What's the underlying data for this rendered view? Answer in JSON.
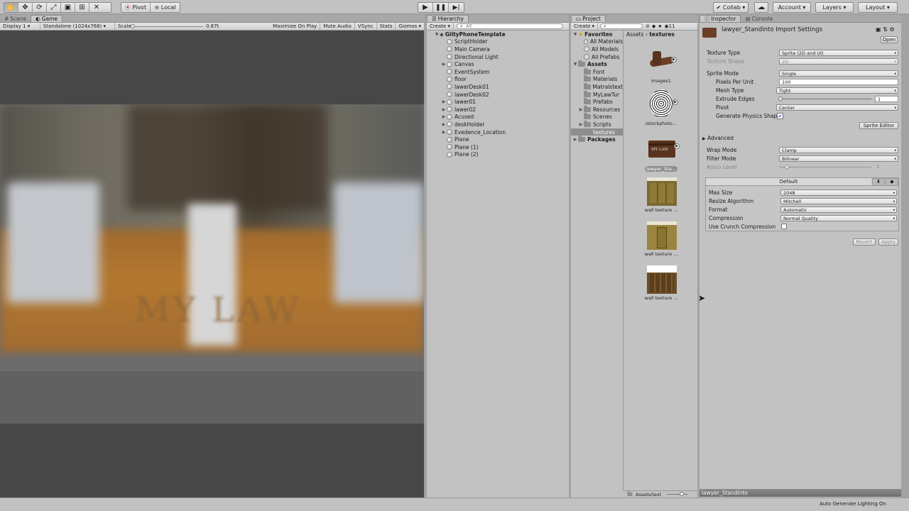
{
  "toolbar": {
    "pivot": "Pivot",
    "local": "Local",
    "collab": "Collab",
    "account": "Account",
    "layers": "Layers",
    "layout": "Layout"
  },
  "scene_tabs": {
    "scene": "Scene",
    "game": "Game"
  },
  "game_bar": {
    "display": "Display 1",
    "resolution": "Standalone (1024x768)",
    "scale_label": "Scale",
    "scale_value": "0.87t",
    "maximize": "Maximize On Play",
    "mute": "Mute Audio",
    "vsync": "VSync",
    "stats": "Stats",
    "gizmos": "Gizmos"
  },
  "game_view": {
    "wall_text": "MY LAW"
  },
  "hierarchy": {
    "tab": "Hierarchy",
    "create": "Create",
    "search_placeholder": "All",
    "scene": "GiltyPhoneTemplate",
    "items": [
      {
        "label": "ScriptHolder",
        "expandable": false
      },
      {
        "label": "Main Camera",
        "expandable": false
      },
      {
        "label": "Directional Light",
        "expandable": false
      },
      {
        "label": "Canvas",
        "expandable": true
      },
      {
        "label": "EventSystem",
        "expandable": false
      },
      {
        "label": "floor",
        "expandable": false
      },
      {
        "label": "lawerDesk01",
        "expandable": false
      },
      {
        "label": "lawerDesk02",
        "expandable": false
      },
      {
        "label": "lawer01",
        "expandable": true
      },
      {
        "label": "lawer02",
        "expandable": true
      },
      {
        "label": "Acused",
        "expandable": true
      },
      {
        "label": "deskHolder",
        "expandable": true
      },
      {
        "label": "Evedence_Location",
        "expandable": true
      },
      {
        "label": "Plane",
        "expandable": false
      },
      {
        "label": "Plane (1)",
        "expandable": false
      },
      {
        "label": "Plane (2)",
        "expandable": false
      }
    ]
  },
  "project": {
    "tab": "Project",
    "create": "Create",
    "count": "11",
    "favorites": "Favorites",
    "fav_items": [
      "All Materials",
      "All Models",
      "All Prefabs"
    ],
    "assets": "Assets",
    "folders": [
      "Font",
      "Materials",
      "Matralstext",
      "MyLawTur",
      "Prefabs",
      "Resources",
      "Scenes",
      "Scripts",
      "textures"
    ],
    "packages": "Packages",
    "breadcrumb_root": "Assets",
    "breadcrumb_sep": "›",
    "breadcrumb_current": "textures",
    "assets_list": [
      {
        "label": "images1"
      },
      {
        "label": "istockphoto..."
      },
      {
        "label": "lawyer_Sta...",
        "thumb_text": "MY LAW"
      },
      {
        "label": "wall texture ..."
      },
      {
        "label": "wall texture ..."
      },
      {
        "label": "wall texture ..."
      }
    ],
    "footer_path": "Assets/text"
  },
  "inspector": {
    "tab": "Inspector",
    "console_tab": "Console",
    "title": "lawyer_Standinto Import Settings",
    "open": "Open",
    "texture_type_label": "Texture Type",
    "texture_type": "Sprite (2D and UI)",
    "texture_shape_label": "Texture Shape",
    "texture_shape": "2D",
    "sprite_mode_label": "Sprite Mode",
    "sprite_mode": "Single",
    "ppu_label": "Pixels Per Unit",
    "ppu": "100",
    "mesh_type_label": "Mesh Type",
    "mesh_type": "Tight",
    "extrude_label": "Extrude Edges",
    "extrude": "1",
    "pivot_label": "Pivot",
    "pivot": "Center",
    "physics_label": "Generate Physics Shap",
    "sprite_editor": "Sprite Editor",
    "advanced": "Advanced",
    "wrap_label": "Wrap Mode",
    "wrap": "Clamp",
    "filter_label": "Filter Mode",
    "filter": "Bilinear",
    "aniso_label": "Aniso Level",
    "aniso": "1",
    "platform_default": "Default",
    "max_size_label": "Max Size",
    "max_size": "2048",
    "resize_label": "Resize Algorithm",
    "resize": "Mitchell",
    "format_label": "Format",
    "format": "Automatic",
    "compression_label": "Compression",
    "compression": "Normal Quality",
    "crunch_label": "Use Crunch Compression",
    "revert": "Revert",
    "apply": "Apply",
    "preview_title": "lawyer_Standinto"
  },
  "status": {
    "text": "Auto Generate Lighting On"
  }
}
